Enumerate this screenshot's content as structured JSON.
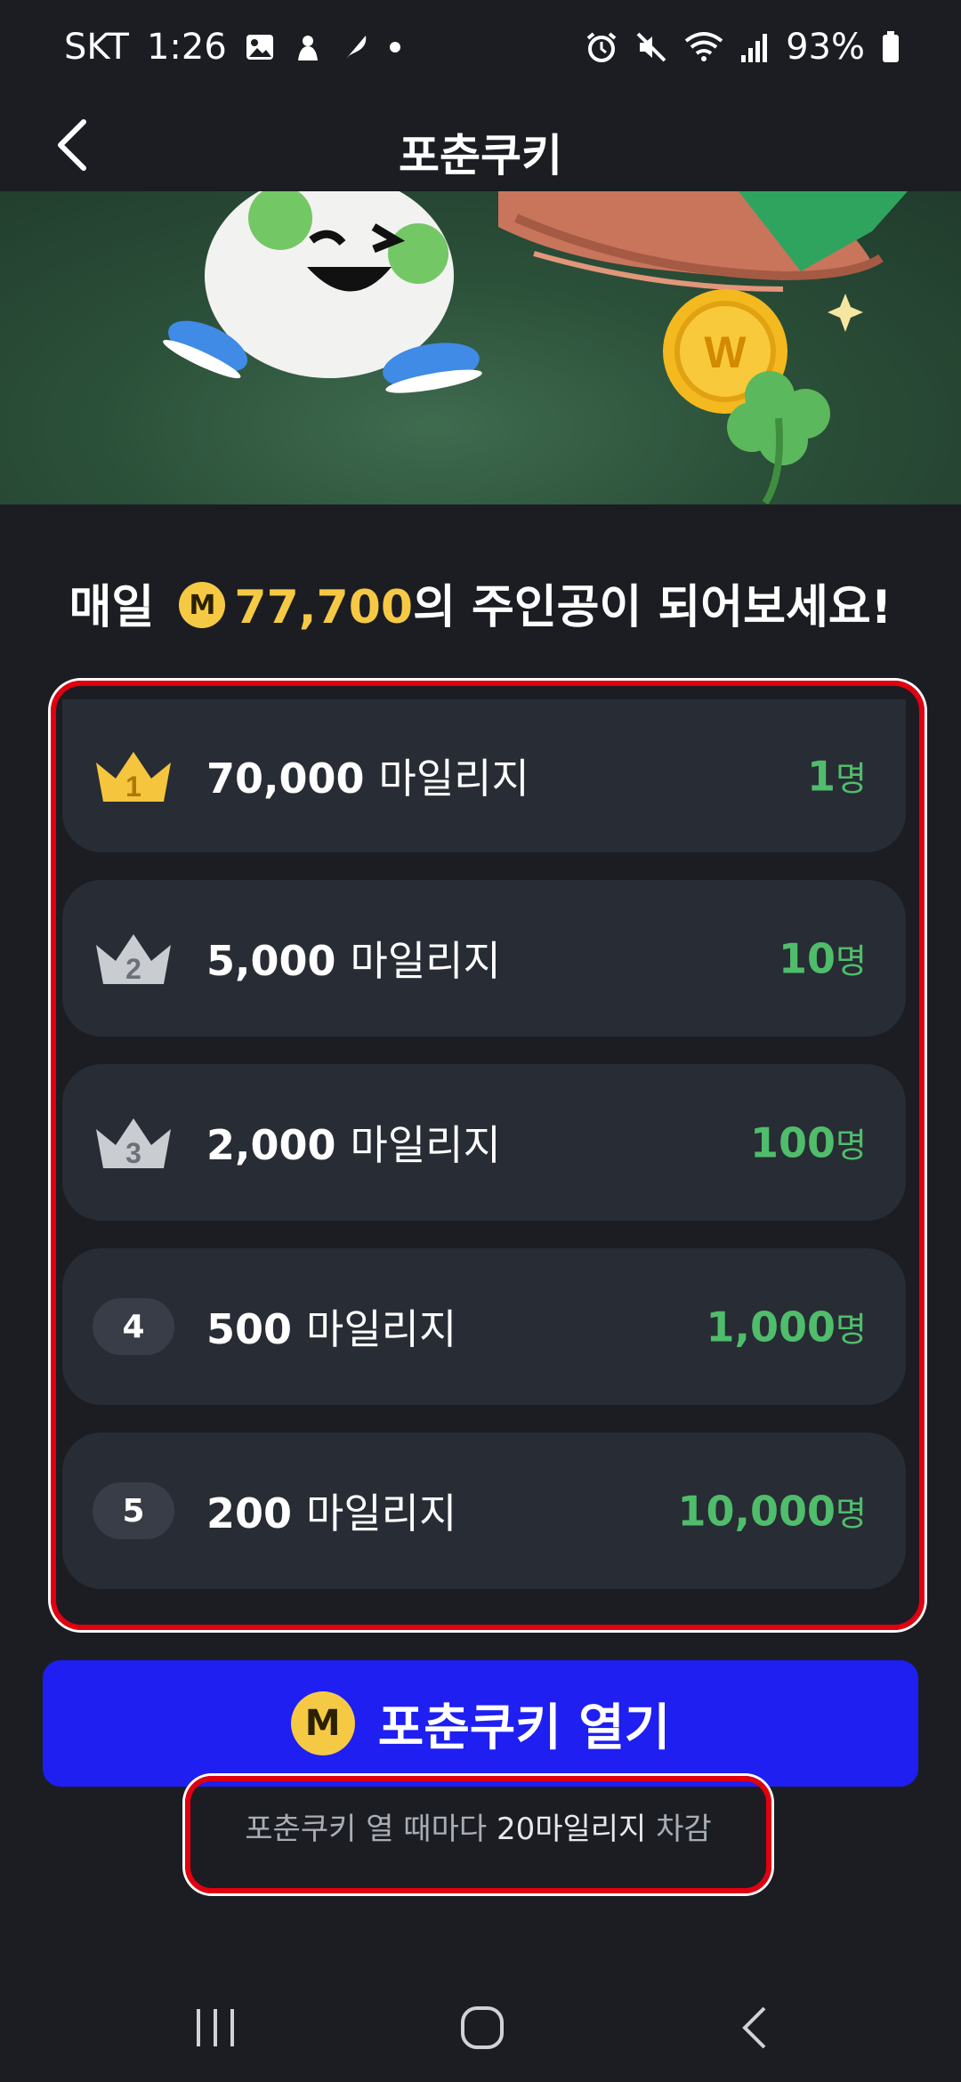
{
  "status_bar": {
    "carrier": "SKT",
    "time": "1:26",
    "battery": "93%"
  },
  "app_bar": {
    "title": "포춘쿠키"
  },
  "headline": {
    "prefix": "매일",
    "coin_letter": "M",
    "amount": "77,700",
    "suffix": "의 주인공이 되어보세요!"
  },
  "prizes": [
    {
      "rank": "1",
      "amount": "70,000",
      "unit": "마일리지",
      "count": "1",
      "count_suffix": "명",
      "rank_style": "gold-crown"
    },
    {
      "rank": "2",
      "amount": "5,000",
      "unit": "마일리지",
      "count": "10",
      "count_suffix": "명",
      "rank_style": "silver-crown"
    },
    {
      "rank": "3",
      "amount": "2,000",
      "unit": "마일리지",
      "count": "100",
      "count_suffix": "명",
      "rank_style": "silver-crown"
    },
    {
      "rank": "4",
      "amount": "500",
      "unit": "마일리지",
      "count": "1,000",
      "count_suffix": "명",
      "rank_style": "badge"
    },
    {
      "rank": "5",
      "amount": "200",
      "unit": "마일리지",
      "count": "10,000",
      "count_suffix": "명",
      "rank_style": "badge"
    }
  ],
  "open_button": {
    "coin_letter": "M",
    "label": "포춘쿠키 열기"
  },
  "deduct_note": {
    "prefix": "포춘쿠키 열 때마다 ",
    "highlight": "20마일리지",
    "suffix": " 차감"
  },
  "colors": {
    "accent_gold": "#f6c945",
    "count_green": "#4fbd6b",
    "button_blue": "#1e1ff0",
    "highlight_red": "#e00010"
  }
}
